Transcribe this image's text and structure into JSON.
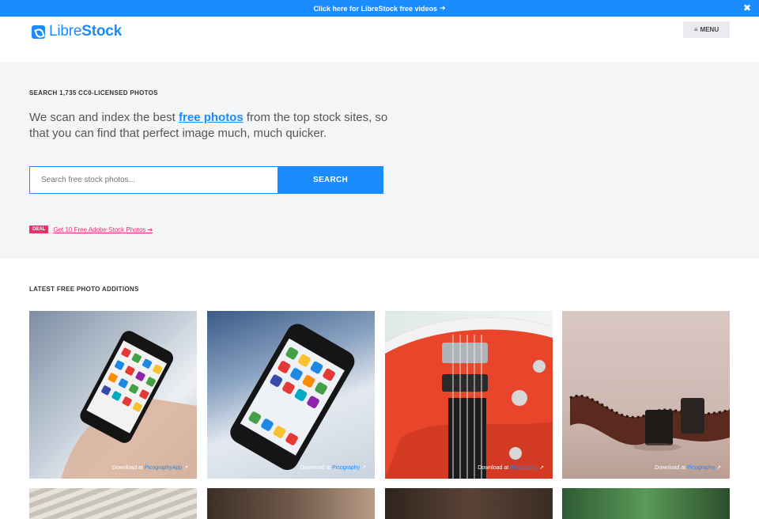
{
  "topbar": {
    "text": "Click here for LibreStock free videos",
    "arrow": "➔",
    "close": "✖"
  },
  "header": {
    "logo_light": "Libre",
    "logo_bold": "Stock",
    "menu_icon": "≡",
    "menu_label": "MENU"
  },
  "hero": {
    "eyebrow": "SEARCH 1,735 CC0-LICENSED PHOTOS",
    "text_before": "We scan and index the best ",
    "text_link": "free photos",
    "text_after": " from the top stock sites, so that you can find that perfect image much, much quicker.",
    "search_placeholder": "Search free stock photos...",
    "search_button": "SEARCH",
    "deal_badge": "DEAL",
    "deal_link": "Get 10 Free Adobe Stock Photos ➔"
  },
  "latest": {
    "title": "LATEST FREE PHOTO ADDITIONS",
    "photos": [
      {
        "credit_prefix": "Download at ",
        "source": "PicographyApp",
        "ext_icon": "↗"
      },
      {
        "credit_prefix": "Download at ",
        "source": "Picography",
        "ext_icon": "↗"
      },
      {
        "credit_prefix": "Download at ",
        "source": "Picography",
        "ext_icon": "↗"
      },
      {
        "credit_prefix": "Download at ",
        "source": "Picography",
        "ext_icon": "↗"
      }
    ]
  },
  "colors": {
    "accent": "#1a8cff",
    "deal": "#e8326a",
    "hero_bg": "#f4f5f7"
  }
}
